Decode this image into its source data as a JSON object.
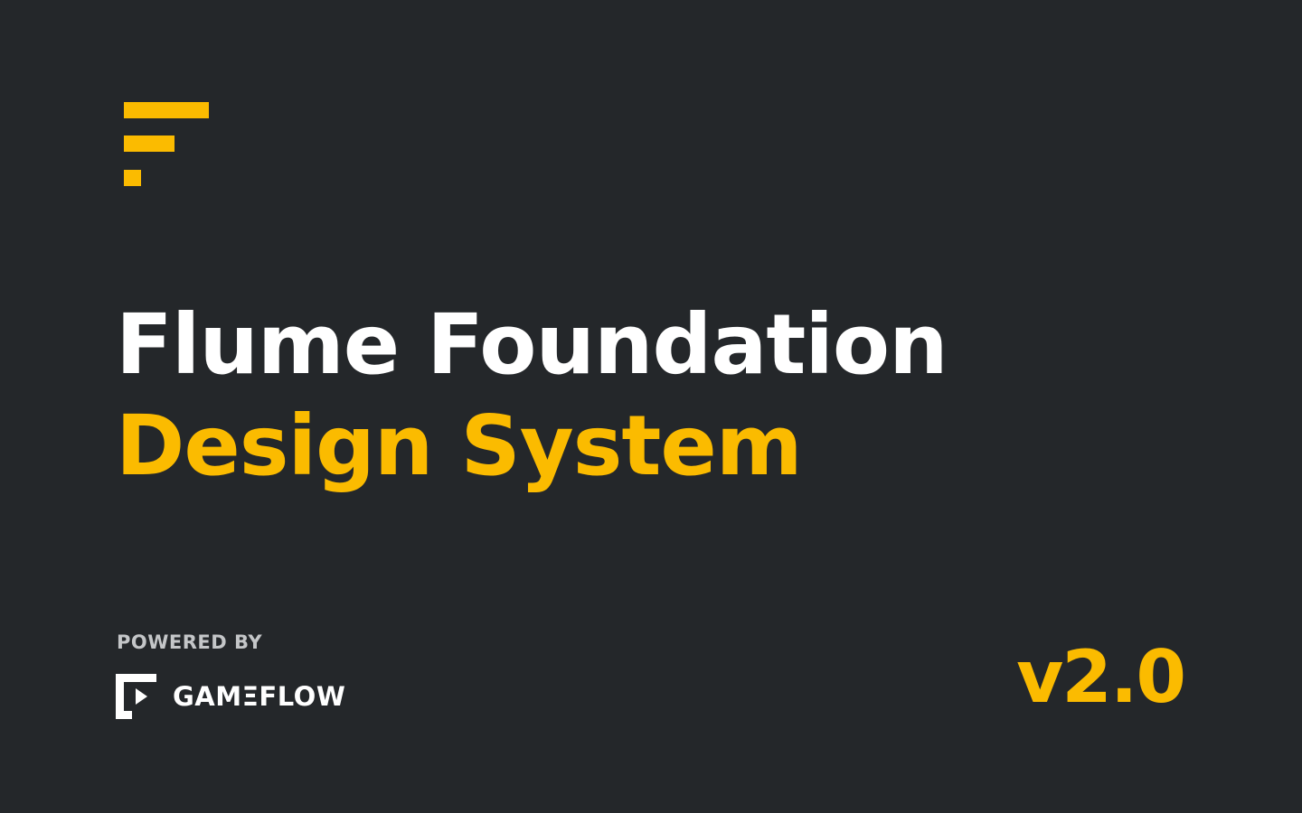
{
  "brand": {
    "mark_icon": "flume-f-icon",
    "accent_color": "#fbbb00",
    "background_color": "#24272a"
  },
  "title": {
    "line1": "Flume Foundation",
    "line2": "Design System"
  },
  "footer": {
    "powered_by": "POWERED BY",
    "partner_icon": "gameflow-play-icon",
    "partner_name": "GAMΞFLOW"
  },
  "version": "v2.0"
}
